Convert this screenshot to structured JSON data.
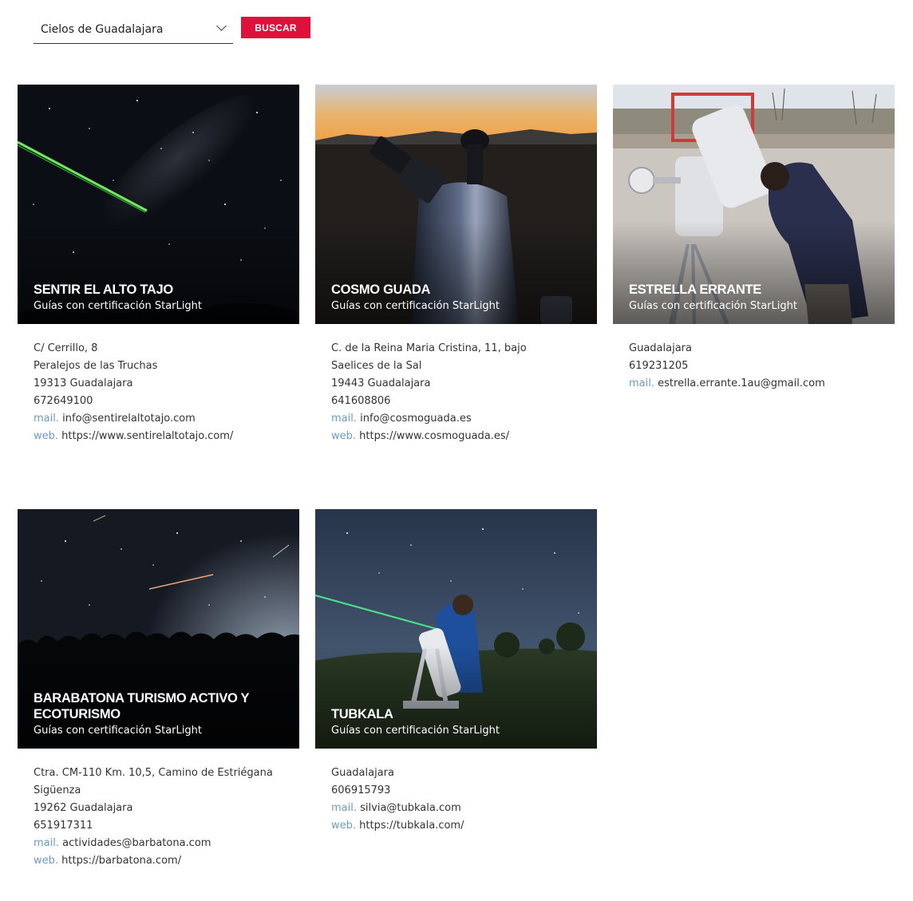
{
  "filter": {
    "selected": "Cielos de Guadalajara",
    "button_label": "BUSCAR"
  },
  "cards": [
    {
      "name": "Sentir el Alto Tajo",
      "subtitle": "Guías con certificación StarLight",
      "address": [
        "C/ Cerrillo, 8",
        "Peralejos de las Truchas",
        "19313 Guadalajara"
      ],
      "phone": "672649100",
      "mail_label": "mail.",
      "mail": "info@sentirelaltotajo.com",
      "web_label": "web.",
      "web": "https://www.sentirelaltotajo.com/"
    },
    {
      "name": "Cosmo Guada",
      "subtitle": "Guías con certificación StarLight",
      "address": [
        "C. de la Reina Maria Cristina, 11, bajo",
        "Saelices de la Sal",
        "19443 Guadalajara"
      ],
      "phone": "641608806",
      "mail_label": "mail.",
      "mail": "info@cosmoguada.es",
      "web_label": "web.",
      "web": "https://www.cosmoguada.es/"
    },
    {
      "name": "Estrella Errante",
      "subtitle": "Guías con certificación StarLight",
      "address": [
        "Guadalajara"
      ],
      "phone": "619231205",
      "mail_label": "mail.",
      "mail": "estrella.errante.1au@gmail.com"
    },
    {
      "name": "Barabatona Turismo Activo y Ecoturismo",
      "subtitle": "Guías con certificación StarLight",
      "address": [
        "Ctra. CM-110 Km. 10,5, Camino de Estriégana",
        "Sigüenza",
        "19262 Guadalajara"
      ],
      "phone": "651917311",
      "mail_label": "mail.",
      "mail": "actividades@barbatona.com",
      "web_label": "web.",
      "web": "https://barbatona.com/"
    },
    {
      "name": "Tubkala",
      "subtitle": "Guías con certificación StarLight",
      "address": [
        "Guadalajara"
      ],
      "phone": "606915793",
      "mail_label": "mail.",
      "mail": "silvia@tubkala.com",
      "web_label": "web.",
      "web": "https://tubkala.com/"
    }
  ]
}
